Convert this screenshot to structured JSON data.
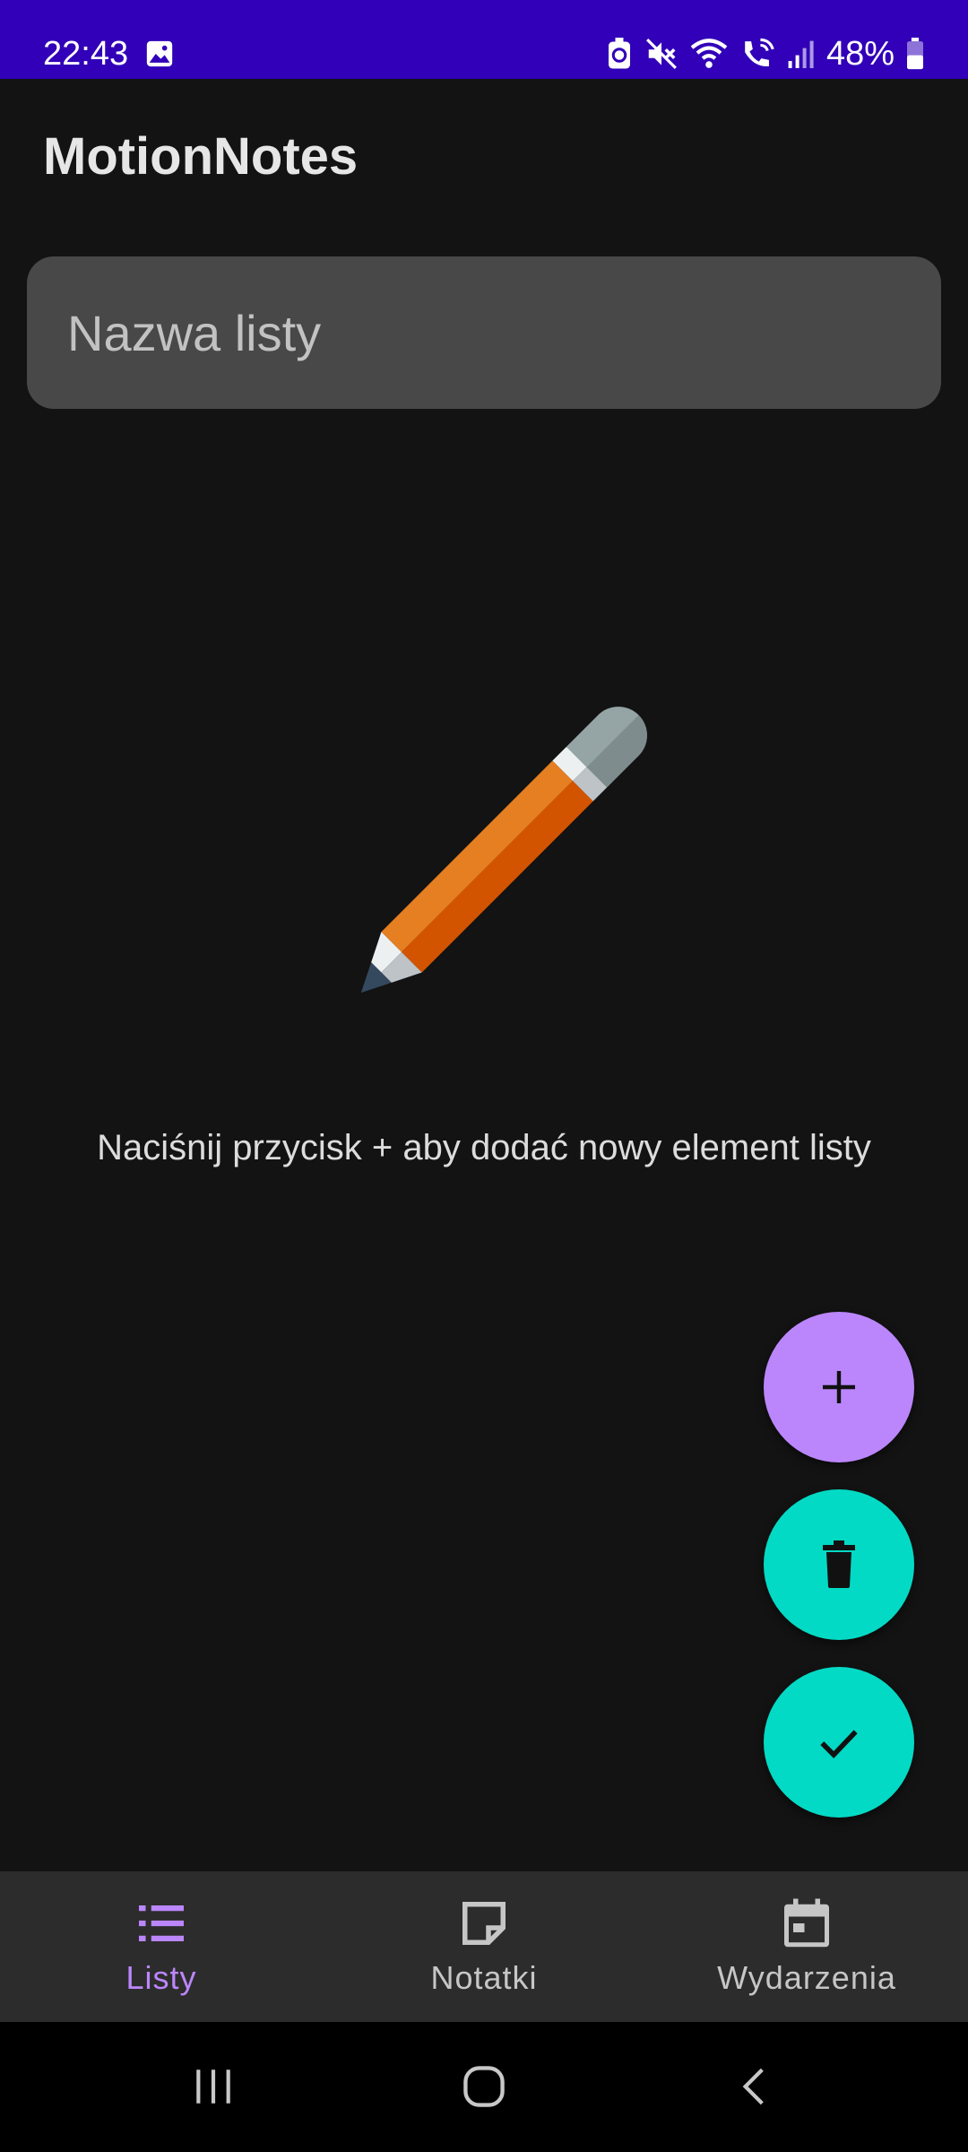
{
  "status_bar": {
    "time": "22:43",
    "battery_percent": "48%",
    "icons": [
      "gallery-icon",
      "battery-saver-icon",
      "mute-icon",
      "wifi-icon",
      "wifi-calling-icon",
      "signal-icon",
      "battery-icon"
    ]
  },
  "app": {
    "title": "MotionNotes"
  },
  "list_name": {
    "placeholder": "Nazwa listy",
    "value": ""
  },
  "empty_state": {
    "illustration": "pencil-icon",
    "hint": "Naciśnij przycisk + aby dodać nowy element listy"
  },
  "fabs": [
    {
      "name": "add",
      "icon": "plus-icon",
      "color": "#bb86fc"
    },
    {
      "name": "delete",
      "icon": "trash-icon",
      "color": "#03dac5"
    },
    {
      "name": "confirm",
      "icon": "check-icon",
      "color": "#03dac5"
    }
  ],
  "bottom_nav": {
    "active_index": 0,
    "items": [
      {
        "label": "Listy",
        "icon": "list-icon"
      },
      {
        "label": "Notatki",
        "icon": "note-icon"
      },
      {
        "label": "Wydarzenia",
        "icon": "calendar-icon"
      }
    ]
  },
  "system_nav": [
    "recents-button",
    "home-button",
    "back-button"
  ],
  "colors": {
    "status_bar": "#3100b8",
    "background": "#131313",
    "accent_purple": "#bb86fc",
    "accent_teal": "#03dac5",
    "nav_background": "#2c2c2c",
    "input_background": "#484848"
  }
}
